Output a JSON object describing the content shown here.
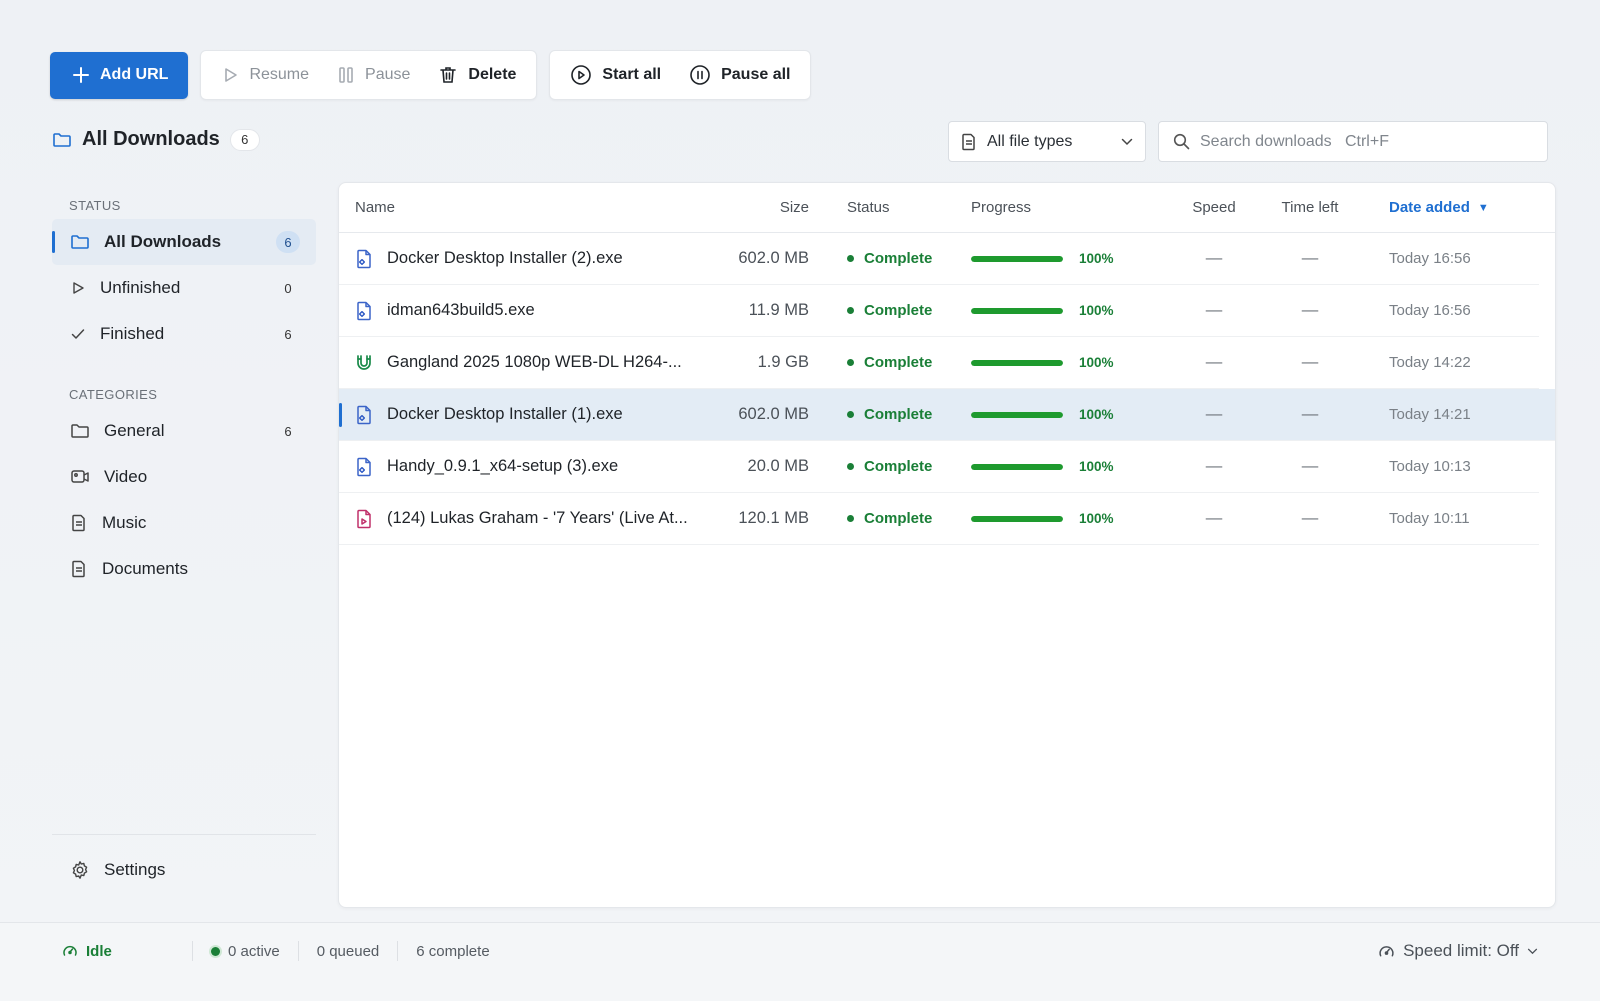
{
  "toolbar": {
    "add_url": "Add URL",
    "resume": "Resume",
    "pause": "Pause",
    "delete": "Delete",
    "start_all": "Start all",
    "pause_all": "Pause all"
  },
  "header": {
    "title": "All Downloads",
    "count": "6",
    "filter_value": "All file types",
    "search_placeholder": "Search downloads   Ctrl+F"
  },
  "sidebar": {
    "status_label": "STATUS",
    "status_items": [
      {
        "label": "All Downloads",
        "count": "6",
        "icon": "folder-icon",
        "active": true
      },
      {
        "label": "Unfinished",
        "count": "0",
        "icon": "play-icon"
      },
      {
        "label": "Finished",
        "count": "6",
        "icon": "check-icon"
      }
    ],
    "categories_label": "CATEGORIES",
    "category_items": [
      {
        "label": "General",
        "count": "6",
        "icon": "folder-icon"
      },
      {
        "label": "Video",
        "icon": "video-icon"
      },
      {
        "label": "Music",
        "icon": "document-icon"
      },
      {
        "label": "Documents",
        "icon": "document-icon"
      }
    ],
    "settings": "Settings"
  },
  "table": {
    "columns": {
      "name": "Name",
      "size": "Size",
      "status": "Status",
      "progress": "Progress",
      "speed": "Speed",
      "time_left": "Time left",
      "date_added": "Date added"
    },
    "rows": [
      {
        "name": "Docker Desktop Installer (2).exe",
        "size": "602.0 MB",
        "status": "Complete",
        "progress": 100,
        "progress_text": "100%",
        "speed": "—",
        "time_left": "—",
        "date": "Today 16:56",
        "icon": "program-file-icon",
        "color": "#3b64c8"
      },
      {
        "name": "idman643build5.exe",
        "size": "11.9 MB",
        "status": "Complete",
        "progress": 100,
        "progress_text": "100%",
        "speed": "—",
        "time_left": "—",
        "date": "Today 16:56",
        "icon": "program-file-icon",
        "color": "#3b64c8"
      },
      {
        "name": "Gangland 2025 1080p WEB-DL H264-...",
        "size": "1.9 GB",
        "status": "Complete",
        "progress": 100,
        "progress_text": "100%",
        "speed": "—",
        "time_left": "—",
        "date": "Today 14:22",
        "icon": "magnet-icon",
        "color": "#1a8a4a"
      },
      {
        "name": "Docker Desktop Installer (1).exe",
        "size": "602.0 MB",
        "status": "Complete",
        "progress": 100,
        "progress_text": "100%",
        "speed": "—",
        "time_left": "—",
        "date": "Today 14:21",
        "icon": "program-file-icon",
        "color": "#3b64c8",
        "selected": true
      },
      {
        "name": "Handy_0.9.1_x64-setup (3).exe",
        "size": "20.0 MB",
        "status": "Complete",
        "progress": 100,
        "progress_text": "100%",
        "speed": "—",
        "time_left": "—",
        "date": "Today 10:13",
        "icon": "program-file-icon",
        "color": "#3b64c8"
      },
      {
        "name": "(124) Lukas Graham - '7 Years' (Live At...",
        "size": "120.1 MB",
        "status": "Complete",
        "progress": 100,
        "progress_text": "100%",
        "speed": "—",
        "time_left": "—",
        "date": "Today 10:11",
        "icon": "media-file-icon",
        "color": "#c0306a"
      }
    ]
  },
  "statusbar": {
    "state": "Idle",
    "active": "0 active",
    "queued": "0 queued",
    "complete": "6 complete",
    "speed_limit": "Speed limit: Off"
  },
  "colors": {
    "accent": "#1f6fd1",
    "success": "#1a7f37",
    "progress_fill": "#1e9a2e"
  }
}
